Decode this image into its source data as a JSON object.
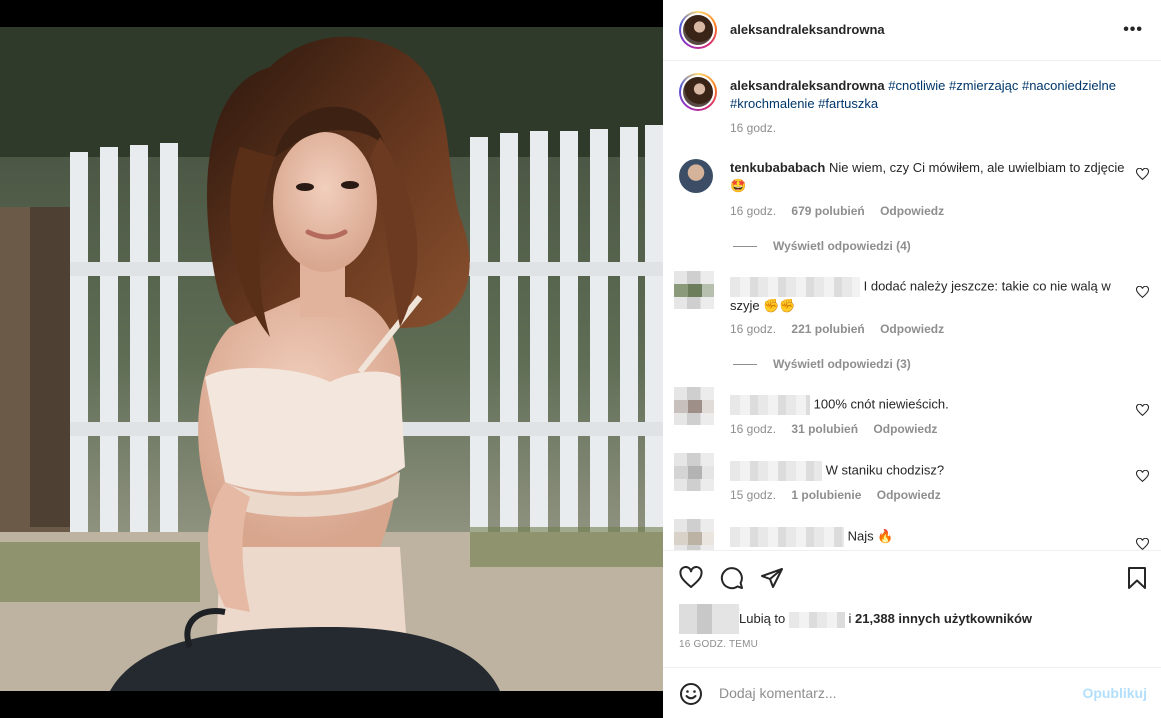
{
  "post": {
    "author": "aleksandraleksandrowna",
    "more_icon": "more-horizontal-icon",
    "caption": {
      "username": "aleksandraleksandrowna",
      "hashtags": [
        "#cnotliwie",
        "#zmierzając",
        "#naconiedzielne",
        "#krochmalenie",
        "#fartuszka"
      ],
      "time": "16 godz."
    }
  },
  "comments": [
    {
      "username": "tenkubababach",
      "text": "Nie wiem, czy Ci mówiłem, ale uwielbiam to zdjęcie🤩",
      "time": "16 godz.",
      "likes": "679 polubień",
      "reply": "Odpowiedz",
      "view_replies": "Wyświetl odpowiedzi (4)"
    },
    {
      "username": "",
      "text": "I dodać należy jeszcze: takie co nie walą w szyje ✊✊",
      "time": "16 godz.",
      "likes": "221 polubień",
      "reply": "Odpowiedz",
      "view_replies": "Wyświetl odpowiedzi (3)"
    },
    {
      "username": "",
      "text": "100% cnót niewieścich.",
      "time": "16 godz.",
      "likes": "31 polubień",
      "reply": "Odpowiedz"
    },
    {
      "username": "",
      "text": "W staniku chodzisz?",
      "time": "15 godz.",
      "likes": "1 polubienie",
      "reply": "Odpowiedz"
    },
    {
      "username": "",
      "text": "Najs 🔥",
      "time": "",
      "likes": "",
      "reply": ""
    }
  ],
  "actions": {
    "like_icon": "heart-icon",
    "comment_icon": "comment-icon",
    "share_icon": "paper-plane-icon",
    "save_icon": "bookmark-icon"
  },
  "likes": {
    "prefix": "Lubią to",
    "connector": "i",
    "others": "21,388 innych użytkowników"
  },
  "timestamp": "16 GODZ. TEMU",
  "add_comment": {
    "placeholder": "Dodaj komentarz...",
    "post_label": "Opublikuj",
    "emoji_icon": "smiley-icon"
  },
  "colors": {
    "link": "#00376b",
    "muted": "#8e8e8e",
    "post_button_disabled": "#b2dffc"
  }
}
